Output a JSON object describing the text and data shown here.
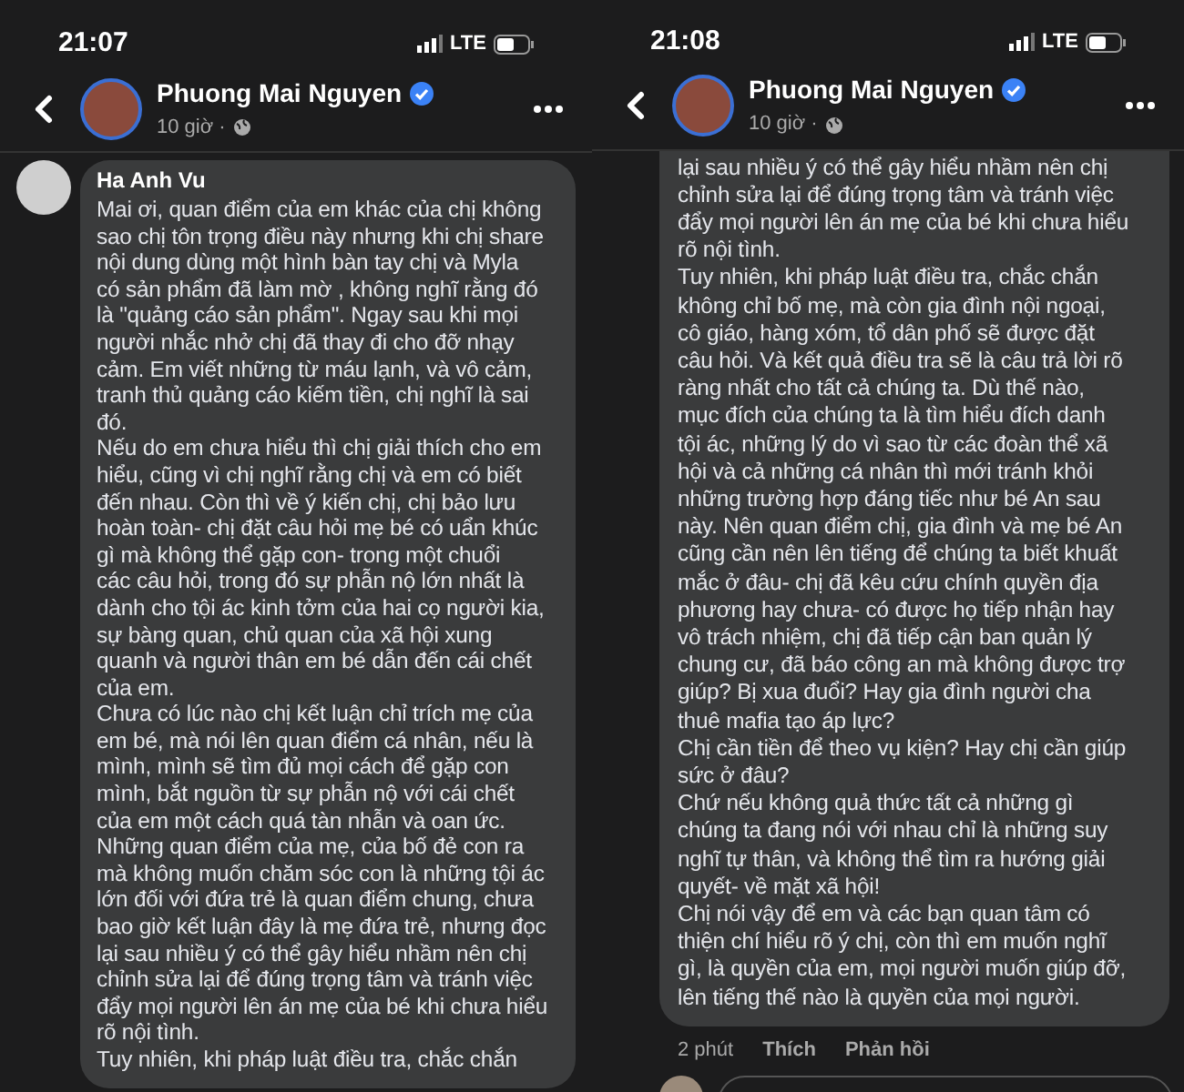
{
  "screens": [
    {
      "status_bar": {
        "time": "21:07",
        "network": "LTE"
      },
      "header": {
        "name": "Phuong Mai Nguyen",
        "meta": "10 giờ ·"
      },
      "comment": {
        "author": "Ha Anh Vu",
        "paragraphs": [
          [
            "Mai ơi, quan điểm của em khác của chị không",
            "sao chị tôn trọng điều này nhưng khi chị share",
            "nội dung dùng một hình bàn tay chị và Myla",
            "có sản phẩm đã làm mờ , không nghĩ rằng đó",
            "là \"quảng cáo sản phẩm\". Ngay sau khi mọi",
            "người nhắc nhở chị đã thay đi cho đỡ nhạy",
            "cảm. Em viết những từ máu lạnh, và vô cảm,",
            "tranh thủ quảng cáo kiếm tiền, chị nghĩ là sai",
            "đó."
          ],
          [
            "Nếu do em chưa hiểu thì chị giải thích cho em",
            "hiểu, cũng vì chị nghĩ rằng chị và em có biết",
            "đến nhau. Còn thì về ý kiến chị, chị bảo lưu",
            "hoàn toàn- chị đặt câu hỏi mẹ bé có uẩn khúc",
            "gì mà không thể gặp con- trong một chuổi",
            "các câu hỏi, trong đó sự phẫn nộ lớn nhất là",
            "dành cho tội ác kinh tởm của hai cọ người kia,",
            "sự bàng quan, chủ quan của xã hội xung",
            "quanh và người thân em bé dẫn đến cái chết",
            "của em."
          ],
          [
            "Chưa có lúc nào chị kết luận chỉ trích mẹ của",
            "em bé, mà nói lên quan điểm cá nhân, nếu là",
            "mình, mình sẽ tìm đủ mọi cách để gặp con",
            "mình, bắt nguồn từ sự phẫn nộ với cái chết",
            "của em một cách quá tàn nhẫn và oan ức."
          ],
          [
            "Những quan điểm của mẹ, của bố đẻ con ra",
            "mà không muốn chăm sóc con là những tội ác",
            "lớn đối với đứa trẻ là quan điểm chung, chưa",
            "bao giờ kết luận đây là mẹ đứa trẻ, nhưng đọc",
            "lại sau nhiều ý có thể gây hiểu nhầm nên chị",
            "chỉnh sửa lại để đúng trọng tâm và tránh việc",
            "đẩy mọi người lên án mẹ của bé khi chưa hiểu",
            "rõ nội tình."
          ],
          [
            "Tuy nhiên, khi pháp luật điều tra, chắc chắn"
          ]
        ]
      }
    },
    {
      "status_bar": {
        "time": "21:08",
        "network": "LTE"
      },
      "header": {
        "name": "Phuong Mai Nguyen",
        "meta": "10 giờ ·"
      },
      "comment": {
        "paragraphs": [
          [
            "lại sau nhiều ý có thể gây hiểu nhầm nên chị",
            "chỉnh sửa lại để đúng trọng tâm và tránh việc",
            "đẩy mọi người lên án mẹ của bé khi chưa hiểu",
            "rõ nội tình."
          ],
          [
            "Tuy nhiên, khi pháp luật điều tra, chắc chắn",
            "không chỉ bố mẹ, mà còn gia đình nội ngoại,",
            "cô giáo, hàng xóm, tổ dân phố sẽ được đặt",
            "câu hỏi. Và kết quả điều tra sẽ là câu trả lời rõ",
            "ràng nhất cho tất cả chúng ta. Dù thế nào,",
            "mục đích của chúng ta là tìm hiểu đích danh",
            "tội ác, những lý do vì sao từ các đoàn thể xã",
            "hội và cả những cá nhân thì mới tránh khỏi",
            "những trường hợp đáng tiếc như bé An sau",
            "này. Nên quan điểm chị, gia đình và mẹ bé An",
            "cũng cần nên lên tiếng để chúng ta biết khuất",
            "mắc ở đâu- chị đã kêu cứu chính quyền địa",
            "phương hay chưa- có được họ tiếp nhận hay",
            "vô trách nhiệm, chị đã tiếp cận ban quản lý",
            "chung cư, đã báo công an mà không được trợ",
            "giúp? Bị xua đuổi? Hay gia đình người cha",
            "thuê mafia tạo áp lực?"
          ],
          [
            "Chị cần tiền để theo vụ kiện? Hay chị cần giúp",
            "sức ở đâu?"
          ],
          [
            "Chứ nếu không quả thức tất cả những gì",
            "chúng ta đang nói với nhau chỉ là những suy",
            "nghĩ tự thân, và không thể tìm ra hướng giải",
            "quyết- về mặt xã hội!"
          ],
          [
            "Chị nói vậy để em và các bạn quan tâm có",
            "thiện chí hiểu rõ ý chị, còn thì em muốn nghĩ",
            "gì, là quyền của em, mọi người muốn giúp đỡ,",
            "lên tiếng thế nào là quyền của mọi người."
          ]
        ]
      },
      "actions": [
        "2 phút",
        "Thích",
        "Phản hồi"
      ]
    }
  ]
}
